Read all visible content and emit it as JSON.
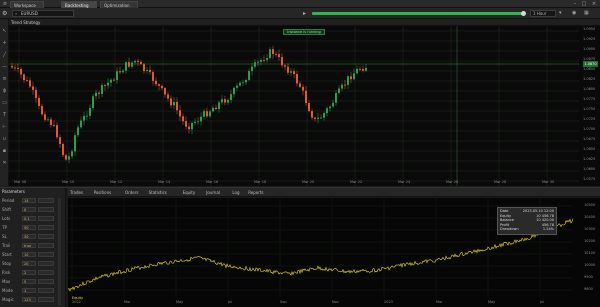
{
  "window": {
    "tabs": [
      {
        "label": "Workspace",
        "active": false
      },
      {
        "label": "Backtesting",
        "active": true
      },
      {
        "label": "Optimization",
        "active": false
      }
    ]
  },
  "toolbar": {
    "symbol": "EURUSD",
    "timeframe": "1 Hour",
    "progress_percent": 100
  },
  "subbar": {
    "label": "Trend Strategy"
  },
  "main_chart": {
    "header_tag": "Instance is running",
    "last_price": "1.0870",
    "price_ticks": [
      "1.0950",
      "1.0925",
      "1.0900",
      "1.0875",
      "1.0850",
      "1.0825",
      "1.0800",
      "1.0775",
      "1.0750",
      "1.0725",
      "1.0700",
      "1.0675",
      "1.0650",
      "1.0625",
      "1.0600",
      "1.0575"
    ],
    "time_ticks": [
      "Mar 08",
      "Mar 10",
      "Mar 12",
      "Mar 14",
      "Mar 16",
      "Mar 18",
      "Mar 20",
      "Mar 22",
      "Mar 24",
      "Mar 26",
      "Mar 28",
      "Mar 30"
    ]
  },
  "parameters": {
    "header": "Parameters",
    "rows": [
      {
        "name": "Period",
        "value": "14"
      },
      {
        "name": "Shift",
        "value": "0"
      },
      {
        "name": "Lots",
        "value": "0.1"
      },
      {
        "name": "TP",
        "value": "50"
      },
      {
        "name": "SL",
        "value": "30"
      },
      {
        "name": "Trail",
        "value": "true"
      },
      {
        "name": "Start",
        "value": "10"
      },
      {
        "name": "Stop",
        "value": "20"
      },
      {
        "name": "Risk",
        "value": "2"
      },
      {
        "name": "Max",
        "value": "5"
      },
      {
        "name": "Mode",
        "value": "1"
      },
      {
        "name": "Magic",
        "value": "123"
      }
    ]
  },
  "bottom_tabs": [
    "Trades",
    "Positions",
    "Orders",
    "Statistics",
    "Equity",
    "Journal",
    "Log",
    "Reports"
  ],
  "equity_chart": {
    "legend": "Equity",
    "tooltip": [
      {
        "k": "Date",
        "v": "2023.05.10 12:00"
      },
      {
        "k": "Equity",
        "v": "10 456.78"
      },
      {
        "k": "Balance",
        "v": "10 420.00"
      },
      {
        "k": "Profit",
        "v": "456.78"
      },
      {
        "k": "Drawdown",
        "v": "1.24%"
      }
    ],
    "y_ticks": [
      "10500",
      "10400",
      "10300",
      "10200",
      "10100",
      "10000",
      "9900",
      "9800"
    ],
    "x_ticks": [
      "2022",
      "Mar",
      "May",
      "Jul",
      "Sep",
      "Nov",
      "2023",
      "Mar",
      "May",
      "Jul"
    ]
  },
  "colors": {
    "bull": "#2e9e4a",
    "bear": "#e25b2f",
    "equity": "#e8e020",
    "grid": "#1e2a1e",
    "hline": "#3a8a3a"
  }
}
